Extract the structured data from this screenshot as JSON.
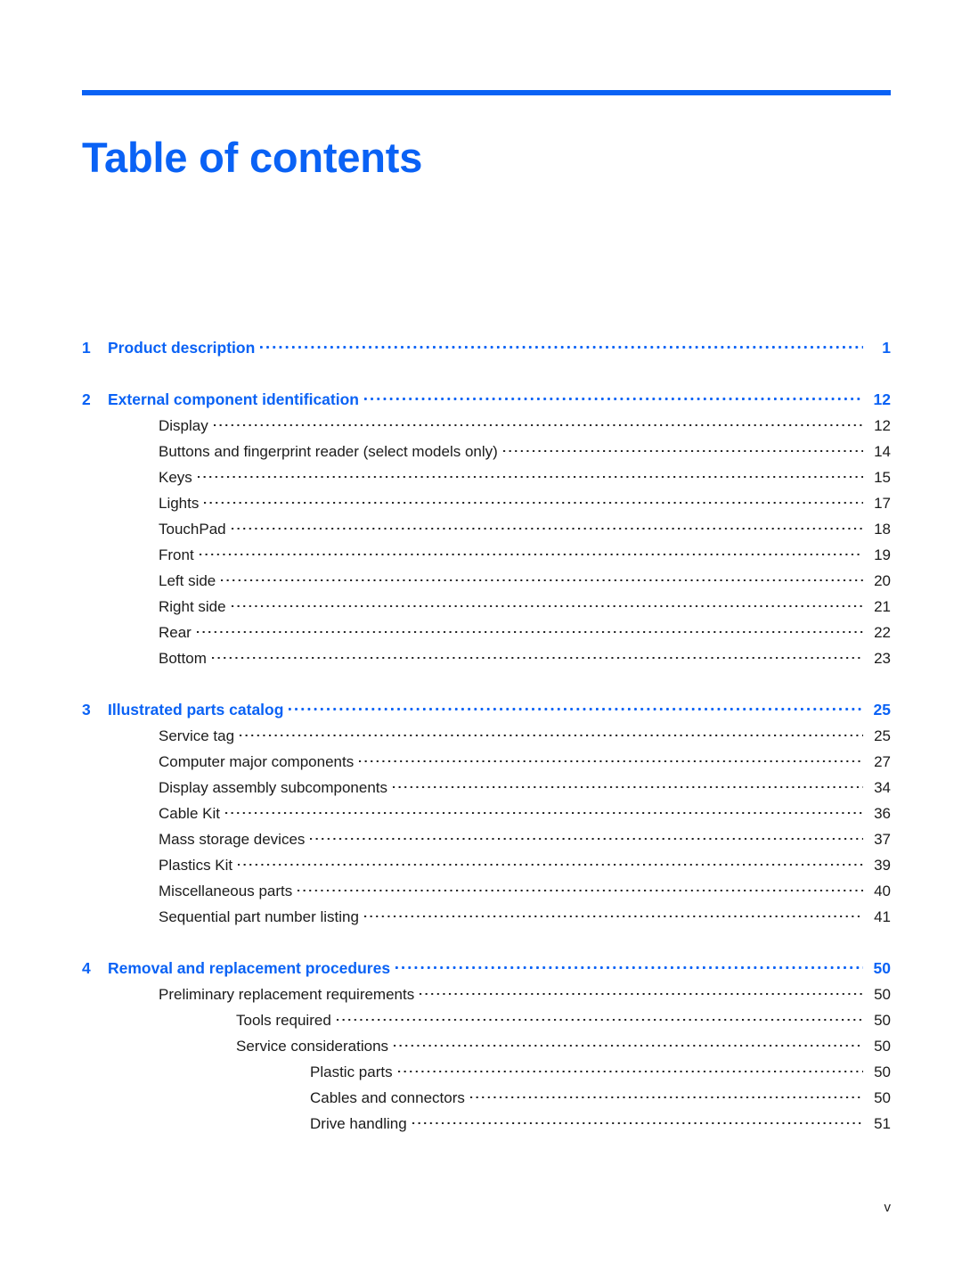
{
  "document": {
    "title": "Table of contents",
    "footer_page_number": "v",
    "accent_color": "#0a62f5",
    "text_color": "#1b1b1b"
  },
  "toc": {
    "entries": [
      {
        "level": 0,
        "number": "1",
        "title": "Product description",
        "page": "1"
      },
      {
        "level": 0,
        "number": "2",
        "title": "External component identification",
        "page": "12"
      },
      {
        "level": 1,
        "number": "",
        "title": "Display",
        "page": "12"
      },
      {
        "level": 1,
        "number": "",
        "title": "Buttons and fingerprint reader (select models only)",
        "page": "14"
      },
      {
        "level": 1,
        "number": "",
        "title": "Keys",
        "page": "15"
      },
      {
        "level": 1,
        "number": "",
        "title": "Lights",
        "page": "17"
      },
      {
        "level": 1,
        "number": "",
        "title": "TouchPad",
        "page": "18"
      },
      {
        "level": 1,
        "number": "",
        "title": "Front",
        "page": "19"
      },
      {
        "level": 1,
        "number": "",
        "title": "Left side",
        "page": "20"
      },
      {
        "level": 1,
        "number": "",
        "title": "Right side",
        "page": "21"
      },
      {
        "level": 1,
        "number": "",
        "title": "Rear",
        "page": "22"
      },
      {
        "level": 1,
        "number": "",
        "title": "Bottom",
        "page": "23"
      },
      {
        "level": 0,
        "number": "3",
        "title": "Illustrated parts catalog",
        "page": "25"
      },
      {
        "level": 1,
        "number": "",
        "title": "Service tag",
        "page": "25"
      },
      {
        "level": 1,
        "number": "",
        "title": "Computer major components",
        "page": "27"
      },
      {
        "level": 1,
        "number": "",
        "title": "Display assembly subcomponents",
        "page": "34"
      },
      {
        "level": 1,
        "number": "",
        "title": "Cable Kit",
        "page": "36"
      },
      {
        "level": 1,
        "number": "",
        "title": "Mass storage devices",
        "page": "37"
      },
      {
        "level": 1,
        "number": "",
        "title": "Plastics Kit",
        "page": "39"
      },
      {
        "level": 1,
        "number": "",
        "title": "Miscellaneous parts",
        "page": "40"
      },
      {
        "level": 1,
        "number": "",
        "title": "Sequential part number listing",
        "page": "41"
      },
      {
        "level": 0,
        "number": "4",
        "title": "Removal and replacement procedures",
        "page": "50"
      },
      {
        "level": 1,
        "number": "",
        "title": "Preliminary replacement requirements",
        "page": "50"
      },
      {
        "level": 2,
        "number": "",
        "title": "Tools required",
        "page": "50"
      },
      {
        "level": 2,
        "number": "",
        "title": "Service considerations",
        "page": "50"
      },
      {
        "level": 3,
        "number": "",
        "title": "Plastic parts",
        "page": "50"
      },
      {
        "level": 3,
        "number": "",
        "title": "Cables and connectors",
        "page": "50"
      },
      {
        "level": 3,
        "number": "",
        "title": "Drive handling",
        "page": "51"
      }
    ]
  }
}
